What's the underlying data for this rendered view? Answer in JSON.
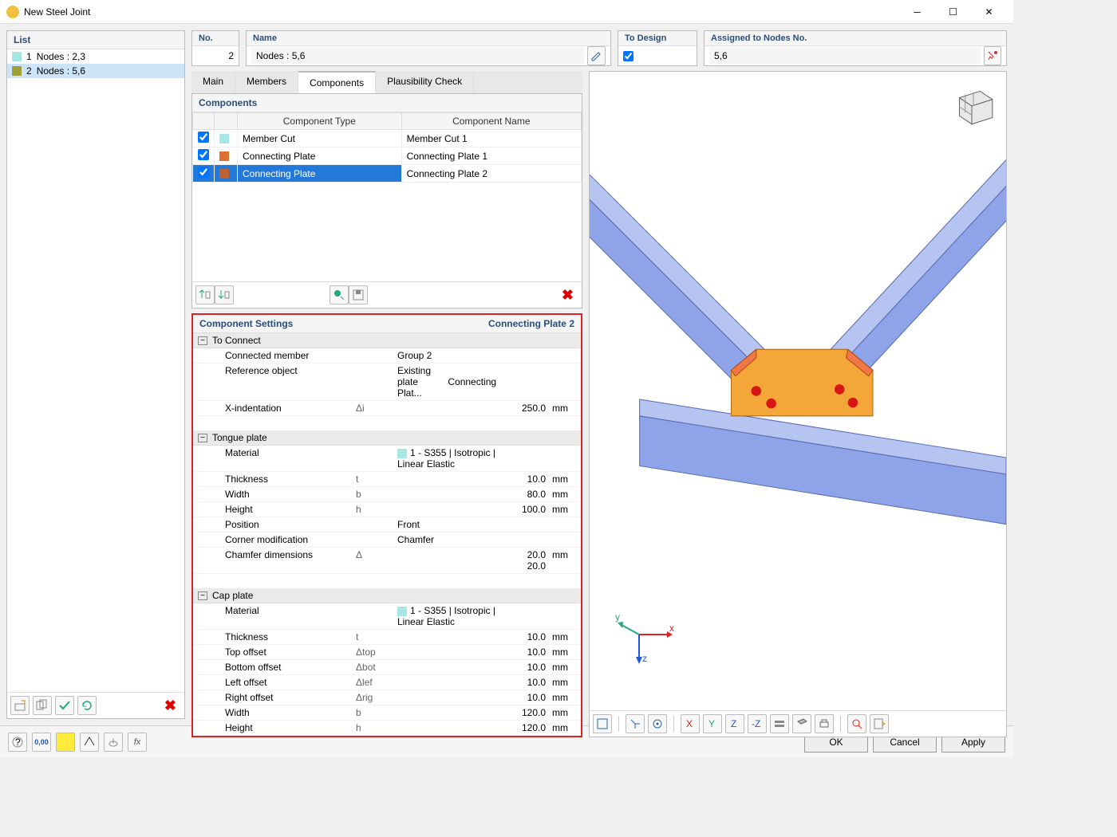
{
  "window": {
    "title": "New Steel Joint"
  },
  "list": {
    "header": "List",
    "items": [
      {
        "idx": "1",
        "label": "Nodes : 2,3",
        "color": "#a8e6e6",
        "selected": false
      },
      {
        "idx": "2",
        "label": "Nodes : 5,6",
        "color": "#a0a038",
        "selected": true
      }
    ]
  },
  "fields": {
    "no_label": "No.",
    "no_value": "2",
    "name_label": "Name",
    "name_value": "Nodes : 5,6",
    "to_design_label": "To Design",
    "to_design_checked": true,
    "assigned_label": "Assigned to Nodes No.",
    "assigned_value": "5,6"
  },
  "tabs": [
    "Main",
    "Members",
    "Components",
    "Plausibility Check"
  ],
  "active_tab": "Components",
  "components": {
    "header": "Components",
    "col_type": "Component Type",
    "col_name": "Component Name",
    "rows": [
      {
        "checked": true,
        "color": "#a8e6e6",
        "type": "Member Cut",
        "name": "Member Cut 1",
        "selected": false
      },
      {
        "checked": true,
        "color": "#e07030",
        "type": "Connecting Plate",
        "name": "Connecting Plate 1",
        "selected": false
      },
      {
        "checked": true,
        "color": "#c06030",
        "type": "Connecting Plate",
        "name": "Connecting Plate 2",
        "selected": true
      }
    ]
  },
  "settings": {
    "header": "Component Settings",
    "title": "Connecting Plate 2",
    "groups": [
      {
        "name": "To Connect",
        "rows": [
          {
            "label": "Connected member",
            "sym": "",
            "val": "Group 2",
            "num": "",
            "unit": ""
          },
          {
            "label": "Reference object",
            "sym": "",
            "val": "Existing plate",
            "num": "",
            "unit": "",
            "extra": "Connecting Plat..."
          },
          {
            "label": "X-indentation",
            "sym": "Δi",
            "val": "",
            "num": "250.0",
            "unit": "mm"
          }
        ]
      },
      {
        "name": "Tongue plate",
        "rows": [
          {
            "label": "Material",
            "sym": "",
            "val": "1 - S355 | Isotropic | Linear Elastic",
            "num": "",
            "unit": "",
            "mat": true
          },
          {
            "label": "Thickness",
            "sym": "t",
            "val": "",
            "num": "10.0",
            "unit": "mm"
          },
          {
            "label": "Width",
            "sym": "b",
            "val": "",
            "num": "80.0",
            "unit": "mm"
          },
          {
            "label": "Height",
            "sym": "h",
            "val": "",
            "num": "100.0",
            "unit": "mm"
          },
          {
            "label": "Position",
            "sym": "",
            "val": "Front",
            "num": "",
            "unit": ""
          },
          {
            "label": "Corner modification",
            "sym": "",
            "val": "Chamfer",
            "num": "",
            "unit": ""
          },
          {
            "label": "Chamfer dimensions",
            "sym": "Δ",
            "val": "",
            "num": "20.0 20.0",
            "unit": "mm"
          }
        ]
      },
      {
        "name": "Cap plate",
        "rows": [
          {
            "label": "Material",
            "sym": "",
            "val": "1 - S355 | Isotropic | Linear Elastic",
            "num": "",
            "unit": "",
            "mat": true
          },
          {
            "label": "Thickness",
            "sym": "t",
            "val": "",
            "num": "10.0",
            "unit": "mm"
          },
          {
            "label": "Top offset",
            "sym": "Δtop",
            "val": "",
            "num": "10.0",
            "unit": "mm"
          },
          {
            "label": "Bottom offset",
            "sym": "Δbot",
            "val": "",
            "num": "10.0",
            "unit": "mm"
          },
          {
            "label": "Left offset",
            "sym": "Δlef",
            "val": "",
            "num": "10.0",
            "unit": "mm"
          },
          {
            "label": "Right offset",
            "sym": "Δrig",
            "val": "",
            "num": "10.0",
            "unit": "mm"
          },
          {
            "label": "Width",
            "sym": "b",
            "val": "",
            "num": "120.0",
            "unit": "mm"
          },
          {
            "label": "Height",
            "sym": "h",
            "val": "",
            "num": "120.0",
            "unit": "mm"
          }
        ]
      }
    ]
  },
  "buttons": {
    "ok": "OK",
    "cancel": "Cancel",
    "apply": "Apply"
  },
  "axes": {
    "x": "x",
    "y": "y",
    "z": "z"
  }
}
